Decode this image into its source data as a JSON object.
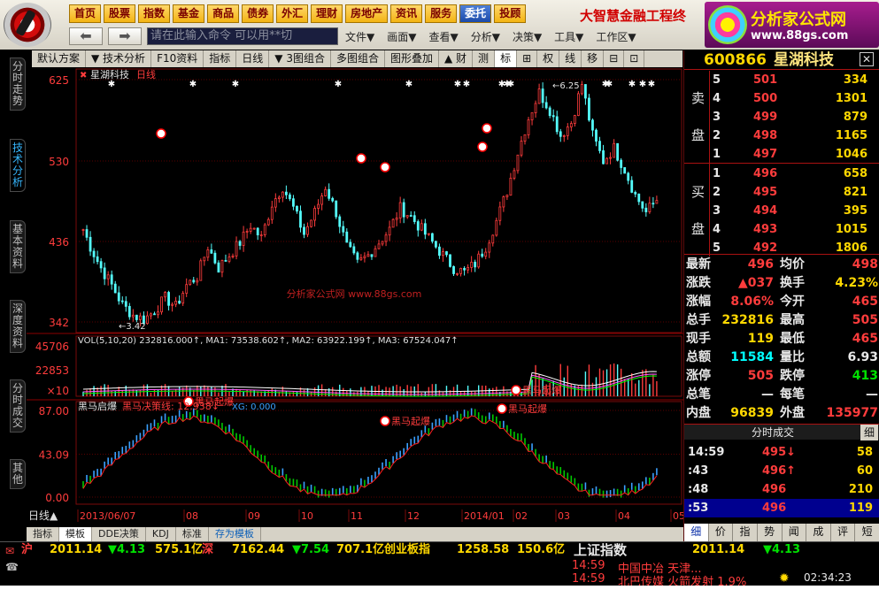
{
  "top_menu": [
    "首页",
    "股票",
    "指数",
    "基金",
    "商品",
    "债券",
    "外汇",
    "理财",
    "房地产",
    "资讯",
    "服务",
    "委托",
    "投顾"
  ],
  "top_menu_active": "委托",
  "brand_text": "大智慧金融工程终",
  "command_placeholder": "请在此输入命令   可以用**切",
  "menus": [
    "文件▼",
    "画面▼",
    "查看▼",
    "分析▼",
    "决策▼",
    "工具▼",
    "工作区▼"
  ],
  "ad": {
    "title": "分析家公式网",
    "url": "www.88gs.com"
  },
  "left_tabs": [
    "分时走势",
    "技术分析",
    "基本资料",
    "深度资料",
    "分时成交",
    "其他"
  ],
  "left_tab_active": "技术分析",
  "toolbar": [
    "默认方案",
    "▼ 技术分析",
    "F10资料",
    "指标",
    "日线",
    "▼ 3图组合",
    "多图组合",
    "图形叠加",
    "▲ 财",
    "测",
    "标",
    "⊞",
    "权",
    "线",
    "移",
    "⊟",
    "⊡"
  ],
  "chart": {
    "stock_name": "星湖科技",
    "period": "日线",
    "watermark": "分析家公式网 www.88gs.com",
    "price_ticks": [
      "625",
      "530",
      "436",
      "342"
    ],
    "high_label": "6.25",
    "low_label": "3.42",
    "vol_header": "VOL(5,10,20) 232816.000↑, MA1: 73538.602↑, MA2: 63922.199↑, MA3: 67524.047↑",
    "vol_ticks": [
      "45706",
      "22853",
      "×10"
    ],
    "ind_header_name": "黑马启爆",
    "ind_header_line1": "黑马决策线: 12.938↓",
    "ind_header_line2": "XG: 0.000",
    "ind_ticks": [
      "87.00",
      "43.09",
      "0.00"
    ],
    "signal_label": "黑马起爆",
    "date_label": "日线",
    "date_ticks": [
      "2013/06/07",
      "08",
      "09",
      "10",
      "11",
      "12",
      "2014/01",
      "02",
      "03",
      "04",
      "05"
    ]
  },
  "chart_data": {
    "type": "line",
    "title": "星湖科技 日线",
    "ylim": [
      342,
      625
    ],
    "close": [
      4.6,
      4.3,
      4.05,
      3.85,
      3.62,
      3.5,
      3.45,
      3.55,
      3.7,
      3.6,
      3.85,
      3.95,
      4.3,
      4.05,
      4.2,
      4.35,
      4.55,
      4.4,
      4.8,
      5.0,
      4.75,
      4.45,
      4.7,
      5.0,
      4.7,
      4.3,
      4.1,
      4.2,
      4.35,
      4.5,
      4.75,
      4.65,
      4.5,
      4.35,
      4.2,
      4.05,
      4.0,
      4.1,
      4.3,
      4.6,
      4.95,
      5.4,
      5.8,
      6.1,
      5.9,
      5.6,
      5.75,
      6.2,
      5.6,
      5.3,
      5.45,
      5.2,
      4.9,
      4.7,
      4.85
    ],
    "volume_ticks": [
      45706,
      22853
    ],
    "indicator_ylim": [
      0,
      87
    ]
  },
  "quote": {
    "code": "600866",
    "name": "星湖科技",
    "sell_label": [
      "卖",
      "盘"
    ],
    "buy_label": [
      "买",
      "盘"
    ],
    "sell": [
      [
        "5",
        "501",
        "334"
      ],
      [
        "4",
        "500",
        "1301"
      ],
      [
        "3",
        "499",
        "879"
      ],
      [
        "2",
        "498",
        "1165"
      ],
      [
        "1",
        "497",
        "1046"
      ]
    ],
    "buy": [
      [
        "1",
        "496",
        "658"
      ],
      [
        "2",
        "495",
        "821"
      ],
      [
        "3",
        "494",
        "395"
      ],
      [
        "4",
        "493",
        "1015"
      ],
      [
        "5",
        "492",
        "1806"
      ]
    ],
    "stats": [
      [
        "最新",
        "496",
        "均价",
        "498"
      ],
      [
        "涨跌",
        "▲037",
        "换手",
        "4.23%"
      ],
      [
        "涨幅",
        "8.06%",
        "今开",
        "465"
      ],
      [
        "总手",
        "232816",
        "最高",
        "505"
      ],
      [
        "现手",
        "119",
        "最低",
        "465"
      ],
      [
        "总额",
        "11584",
        "量比",
        "6.93"
      ],
      [
        "涨停",
        "505",
        "跌停",
        "413"
      ],
      [
        "总笔",
        "—",
        "每笔",
        "—"
      ],
      [
        "内盘",
        "96839",
        "外盘",
        "135977"
      ]
    ],
    "ticks_title": "分时成交",
    "ticks_toggle": "细",
    "ticks": [
      [
        "14:59",
        "495↓",
        "58"
      ],
      [
        ":43",
        "496↑",
        "60"
      ],
      [
        ":48",
        "496",
        "210"
      ],
      [
        ":53",
        "496",
        "119"
      ]
    ],
    "bottom_tabs": [
      "细",
      "价",
      "指",
      "势",
      "闻",
      "成",
      "评",
      "短"
    ]
  },
  "bottom_tabs": [
    "指标",
    "模板",
    "DDE决策",
    "KDJ",
    "标准",
    "存为模板"
  ],
  "status": {
    "sh_label": "沪",
    "sh_idx": "2011.14",
    "sh_chg": "▼4.13",
    "sh_amt": "575.1亿",
    "sz_label": "深",
    "sz_idx": "7162.44",
    "sz_chg": "▼7.54",
    "sz_amt": "707.1亿",
    "cyb_label": "创业板指",
    "cyb_idx": "1258.58",
    "cyb_amt": "150.6亿",
    "right_label": "上证指数",
    "right_idx": "2011.14",
    "right_chg": "▼4.13"
  },
  "news": [
    {
      "time": "14:59",
      "text": "中国中冶 天津..."
    },
    {
      "time": "14:59",
      "text": "北巴传媒 火箭发射 1.9%"
    }
  ],
  "clock": "02:34:23"
}
